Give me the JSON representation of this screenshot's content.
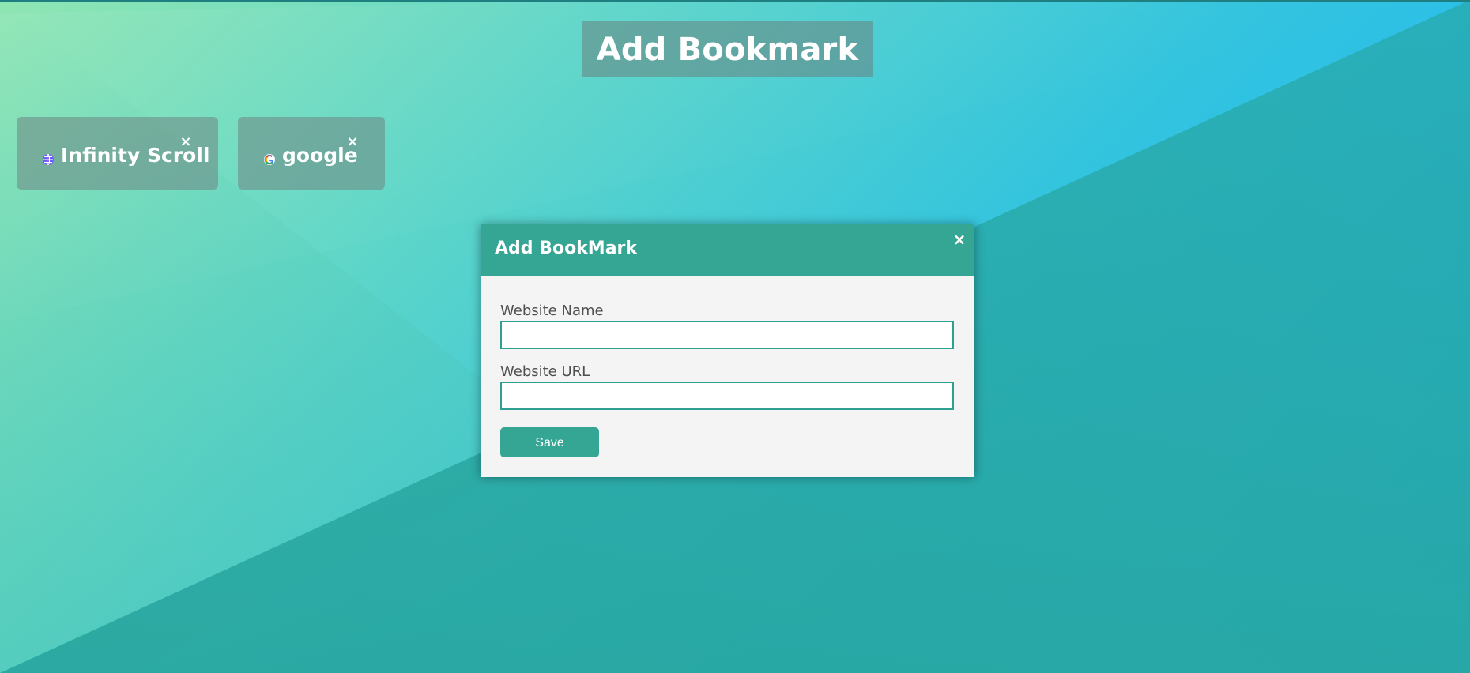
{
  "page": {
    "title_button_label": "Add Bookmark"
  },
  "bookmarks": [
    {
      "name": "Infinity Scroll",
      "favicon_icon": "globe-icon",
      "remove_icon": "close-icon"
    },
    {
      "name": "google",
      "favicon_icon": "google-icon",
      "remove_icon": "close-icon"
    }
  ],
  "modal": {
    "title": "Add BookMark",
    "close_icon": "close-icon",
    "fields": {
      "website_name_label": "Website Name",
      "website_name_value": "",
      "website_url_label": "Website URL",
      "website_url_value": ""
    },
    "save_label": "Save"
  },
  "colors": {
    "accent": "#35a594",
    "modal_bg": "#f4f4f4",
    "card_bg": "#6f8985",
    "title_button_bg": "#678683",
    "text_white": "#ffffff",
    "label_text": "#4f4f4f"
  }
}
